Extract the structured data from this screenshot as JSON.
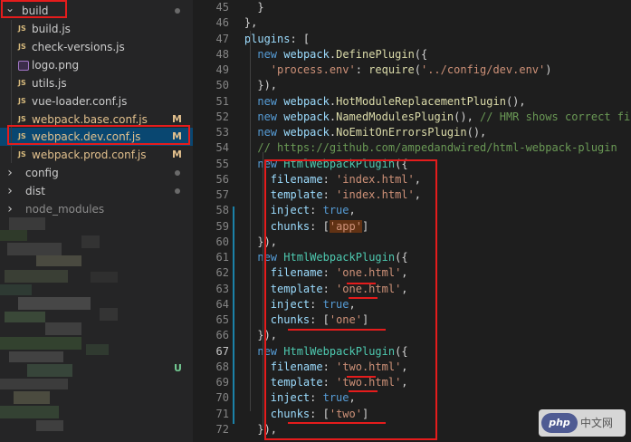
{
  "explorer": {
    "items": [
      {
        "label": "build",
        "type": "folder",
        "open": true,
        "indent": 0
      },
      {
        "label": "build.js",
        "type": "js"
      },
      {
        "label": "check-versions.js",
        "type": "js"
      },
      {
        "label": "logo.png",
        "type": "image"
      },
      {
        "label": "utils.js",
        "type": "js"
      },
      {
        "label": "vue-loader.conf.js",
        "type": "js"
      },
      {
        "label": "webpack.base.conf.js",
        "type": "js",
        "badge": "M"
      },
      {
        "label": "webpack.dev.conf.js",
        "type": "js",
        "badge": "M",
        "selected": true
      },
      {
        "label": "webpack.prod.conf.js",
        "type": "js",
        "badge": "M"
      },
      {
        "label": "config",
        "type": "folder",
        "open": false
      },
      {
        "label": "dist",
        "type": "folder",
        "open": false
      },
      {
        "label": "node_modules",
        "type": "folder",
        "open": false
      }
    ],
    "untracked_badge": "U"
  },
  "editor": {
    "lines": [
      {
        "n": "45",
        "html": "<span class='pun'>      }</span>"
      },
      {
        "n": "46",
        "html": "<span class='pun'>    },</span>"
      },
      {
        "n": "47",
        "html": "<span class='id'>    plugins</span><span class='pun'>: [</span>"
      },
      {
        "n": "48",
        "html": "      <span class='kw'>new</span> <span class='id'>webpack</span><span class='pun'>.</span><span class='fn'>DefinePlugin</span><span class='pun'>({</span>"
      },
      {
        "n": "49",
        "html": "        <span class='str'>'process.env'</span><span class='pun'>: </span><span class='fn'>require</span><span class='pun'>(</span><span class='str'>'../config/dev.env'</span><span class='pun'>)</span>"
      },
      {
        "n": "50",
        "html": "<span class='pun'>      }),</span>"
      },
      {
        "n": "51",
        "html": "      <span class='kw'>new</span> <span class='id'>webpack</span><span class='pun'>.</span><span class='fn'>HotModuleReplacementPlugin</span><span class='pun'>(),</span>"
      },
      {
        "n": "52",
        "html": "      <span class='kw'>new</span> <span class='id'>webpack</span><span class='pun'>.</span><span class='fn'>NamedModulesPlugin</span><span class='pun'>(), </span><span class='cmt'>// HMR shows correct fi</span>"
      },
      {
        "n": "53",
        "html": "      <span class='kw'>new</span> <span class='id'>webpack</span><span class='pun'>.</span><span class='fn'>NoEmitOnErrorsPlugin</span><span class='pun'>(),</span>"
      },
      {
        "n": "54",
        "html": "      <span class='cmt'>// https://github.com/ampedandwired/html-webpack-plugin</span>"
      },
      {
        "n": "55",
        "html": "      <span class='kw'>new</span> <span class='cls'>HtmlWebpackPlugin</span><span class='pun'>({</span>"
      },
      {
        "n": "56",
        "html": "        <span class='id'>filename</span><span class='pun'>: </span><span class='str'>'index.html'</span><span class='pun'>,</span>"
      },
      {
        "n": "57",
        "html": "        <span class='id'>template</span><span class='pun'>: </span><span class='str'>'index.html'</span><span class='pun'>,</span>"
      },
      {
        "n": "58",
        "html": "        <span class='id'>inject</span><span class='pun'>: </span><span class='bool'>true</span><span class='pun'>,</span>"
      },
      {
        "n": "59",
        "html": "        <span class='id'>chunks</span><span class='pun'>: [</span><span class='str hl'>'app'</span><span class='pun'>]</span>"
      },
      {
        "n": "60",
        "html": "<span class='pun'>      }),</span>"
      },
      {
        "n": "61",
        "html": "      <span class='kw'>new</span> <span class='cls'>HtmlWebpackPlugin</span><span class='pun'>({</span>"
      },
      {
        "n": "62",
        "html": "        <span class='id'>filename</span><span class='pun'>: </span><span class='str'>'one.html'</span><span class='pun'>,</span>"
      },
      {
        "n": "63",
        "html": "        <span class='id'>template</span><span class='pun'>: </span><span class='str'>'one.html'</span><span class='pun'>,</span>"
      },
      {
        "n": "64",
        "html": "        <span class='id'>inject</span><span class='pun'>: </span><span class='bool'>true</span><span class='pun'>,</span>"
      },
      {
        "n": "65",
        "html": "        <span class='id'>chunks</span><span class='pun'>: [</span><span class='str'>'one'</span><span class='pun'>]</span>"
      },
      {
        "n": "66",
        "html": "<span class='pun'>      }),</span>"
      },
      {
        "n": "67",
        "html": "      <span class='kw'>new</span> <span class='cls'>HtmlWebpackPlugin</span><span class='pun'>({</span>"
      },
      {
        "n": "68",
        "html": "        <span class='id'>filename</span><span class='pun'>: </span><span class='str'>'two.html'</span><span class='pun'>,</span>"
      },
      {
        "n": "69",
        "html": "        <span class='id'>template</span><span class='pun'>: </span><span class='str'>'two.html'</span><span class='pun'>,</span>"
      },
      {
        "n": "70",
        "html": "        <span class='id'>inject</span><span class='pun'>: </span><span class='bool'>true</span><span class='pun'>,</span>"
      },
      {
        "n": "71",
        "html": "        <span class='id'>chunks</span><span class='pun'>: [</span><span class='str'>'two'</span><span class='pun'>]</span>"
      },
      {
        "n": "72",
        "html": "<span class='pun'>      }),</span>"
      }
    ]
  },
  "watermark": {
    "logo": "php",
    "site": "中文网"
  },
  "colors": {
    "highlight_box": "#e51c1c",
    "selection": "#094771",
    "modified_badge": "#e2c08d"
  }
}
